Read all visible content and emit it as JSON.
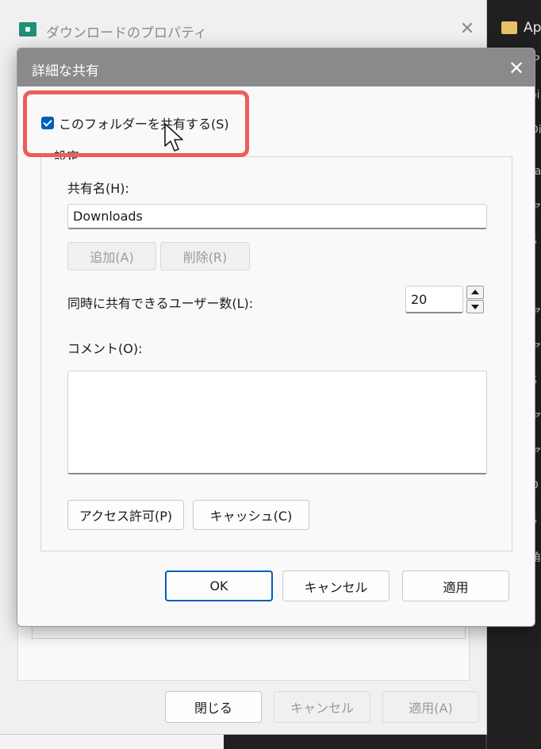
{
  "background": {
    "top_item": "ﾗﾗ ",
    "folder_label": "Ap",
    "peek_letters": [
      "iP",
      "oi",
      "Di",
      "ra",
      "ア",
      "S",
      "(",
      "ア",
      "ア",
      "S",
      "ア",
      "ア",
      "D",
      "S",
      "角"
    ]
  },
  "outer_window": {
    "title": "ダウンロードのプロパティ",
    "close_glyph": "✕",
    "buttons": {
      "close": "閉じる",
      "cancel": "キャンセル",
      "apply": "適用(A)"
    }
  },
  "dialog": {
    "title": "詳細な共有",
    "close_glyph": "✕",
    "share_checkbox": {
      "label": "このフォルダーを共有する(S)",
      "checked": true
    },
    "settings_group": {
      "legend": "設定",
      "share_name_label": "共有名(H):",
      "share_name_value": "Downloads",
      "add_button": "追加(A)",
      "remove_button": "削除(R)",
      "user_limit_label": "同時に共有できるユーザー数(L):",
      "user_limit_value": "20",
      "comment_label": "コメント(O):",
      "comment_value": "",
      "permissions_button": "アクセス許可(P)",
      "caching_button": "キャッシュ(C)"
    },
    "footer": {
      "ok": "OK",
      "cancel": "キャンセル",
      "apply": "適用"
    }
  },
  "colors": {
    "accent": "#005fb8",
    "highlight_annotation": "#ee5c5c",
    "titlebar": "#8a8a8a"
  }
}
